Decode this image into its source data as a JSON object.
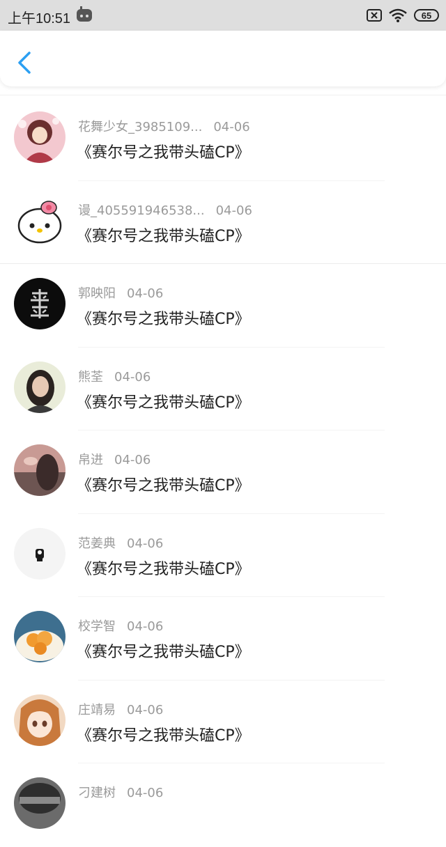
{
  "status_bar": {
    "time": "上午10:51",
    "battery": "65",
    "icons": [
      "game-controller-icon",
      "sim-absent-icon",
      "wifi-icon",
      "battery-icon"
    ]
  },
  "header": {
    "back_icon": "chevron-left-icon"
  },
  "colors": {
    "accent": "#2b9ff2",
    "status_bg": "#dedede",
    "name_text": "#9a9a9a",
    "title_text": "#222222"
  },
  "items": [
    {
      "name": "花舞少女_3985109...",
      "date": "04-06",
      "title": "《赛尔号之我带头磕CP》"
    },
    {
      "name": "谩_405591946538...",
      "date": "04-06",
      "title": "《赛尔号之我带头磕CP》"
    },
    {
      "name": "郭映阳",
      "date": "04-06",
      "title": "《赛尔号之我带头磕CP》"
    },
    {
      "name": "熊荃",
      "date": "04-06",
      "title": "《赛尔号之我带头磕CP》"
    },
    {
      "name": "帛进",
      "date": "04-06",
      "title": "《赛尔号之我带头磕CP》"
    },
    {
      "name": "范姜典",
      "date": "04-06",
      "title": "《赛尔号之我带头磕CP》"
    },
    {
      "name": "校学智",
      "date": "04-06",
      "title": "《赛尔号之我带头磕CP》"
    },
    {
      "name": "庄靖易",
      "date": "04-06",
      "title": "《赛尔号之我带头磕CP》"
    },
    {
      "name": "刁建树",
      "date": "04-06",
      "title": ""
    }
  ]
}
